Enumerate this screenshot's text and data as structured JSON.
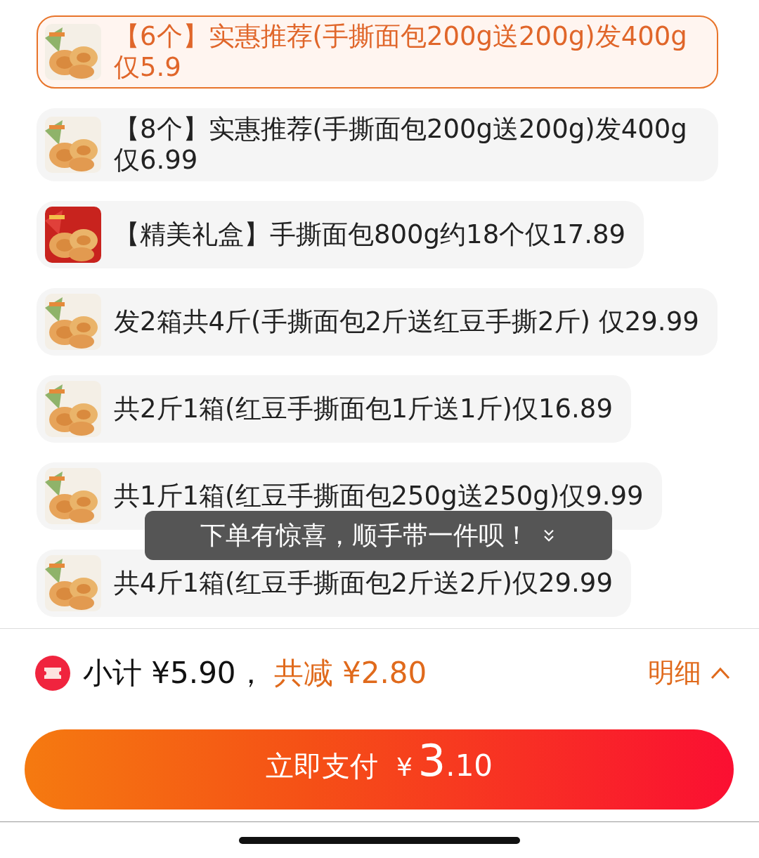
{
  "options": [
    {
      "label": "【6个】实惠推荐(手撕面包200g送200g)发400g仅5.9",
      "selected": true
    },
    {
      "label": "【8个】实惠推荐(手撕面包200g送200g)发400g仅6.99",
      "selected": false
    },
    {
      "label": "【精美礼盒】手撕面包800g约18个仅17.89",
      "selected": false
    },
    {
      "label": "发2箱共4斤(手撕面包2斤送红豆手撕2斤) 仅29.99",
      "selected": false
    },
    {
      "label": "共2斤1箱(红豆手撕面包1斤送1斤)仅16.89",
      "selected": false
    },
    {
      "label": "共1斤1箱(红豆手撕面包250g送250g)仅9.99",
      "selected": false
    },
    {
      "label": "共4斤1箱(红豆手撕面包2斤送2斤)仅29.99",
      "selected": false
    }
  ],
  "toast": {
    "text": "下单有惊喜，顺手带一件呗！"
  },
  "summary": {
    "subtotal": "小计 ¥5.90，",
    "discount": "共减 ¥2.80",
    "details_link": "明细"
  },
  "pay_button": {
    "label": "立即支付",
    "currency": "¥",
    "amount_integer": "3",
    "amount_decimal": ".10"
  }
}
